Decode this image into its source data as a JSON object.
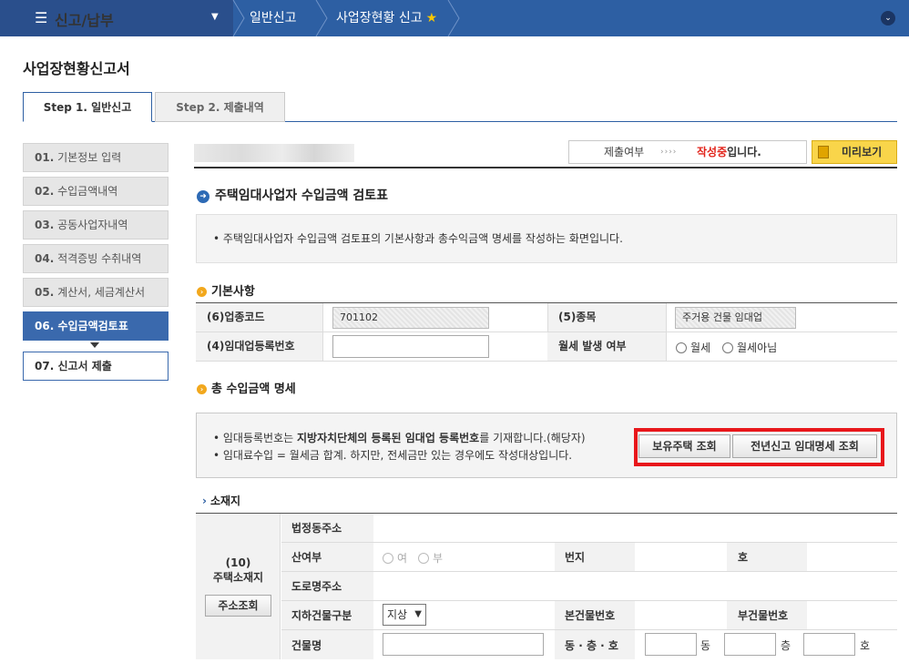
{
  "nav": {
    "menu_label": "신고/납부",
    "crumb1": "일반신고",
    "crumb2": "사업장현황 신고",
    "star": "★"
  },
  "page": {
    "title": "사업장현황신고서"
  },
  "tabs": {
    "step1": "Step 1. 일반신고",
    "step2": "Step 2. 제출내역"
  },
  "sidebar": {
    "items": [
      {
        "num": "01.",
        "label": "기본정보 입력"
      },
      {
        "num": "02.",
        "label": "수입금액내역"
      },
      {
        "num": "03.",
        "label": "공동사업자내역"
      },
      {
        "num": "04.",
        "label": "적격증빙 수취내역"
      },
      {
        "num": "05.",
        "label": "계산서, 세금계산서"
      },
      {
        "num": "06.",
        "label": "수입금액검토표"
      },
      {
        "num": "07.",
        "label": "신고서 제출"
      }
    ]
  },
  "status": {
    "label": "제출여부",
    "arrows": "››››",
    "value": "작성중",
    "suffix": "입니다."
  },
  "preview_button": "미리보기",
  "section": {
    "title": "주택임대사업자 수입금액 검토표",
    "info": "• 주택임대사업자 수입금액 검토표의 기본사항과 총수익금액 명세를 작성하는 화면입니다."
  },
  "basic": {
    "title": "기본사항",
    "industry_code_label": "(6)업종코드",
    "industry_code_value": "701102",
    "type_label": "(5)종목",
    "type_value": "주거용 건물 임대업",
    "reg_no_label": "(4)임대업등록번호",
    "reg_no_value": "",
    "monthly_label": "월세 발생 여부",
    "monthly_yes": "월세",
    "monthly_no": "월세아님"
  },
  "income": {
    "title": "총 수입금액 명세",
    "notice1_a": "• 임대등록번호는 ",
    "notice1_b": "지방자치단체의 등록된 임대업 등록번호",
    "notice1_c": "를 기재합니다.(해당자)",
    "notice2": "• 임대료수입 = 월세금 합계. 하지만, 전세금만 있는 경우에도 작성대상입니다.",
    "btn_owned": "보유주택 조회",
    "btn_prev": "전년신고 임대명세 조회"
  },
  "location": {
    "title": "소재지",
    "left_title_1": "(10)",
    "left_title_2": "주택소재지",
    "addr_btn": "주소조회",
    "legal_addr": "법정동주소",
    "mountain": "산여부",
    "mountain_yes": "여",
    "mountain_no": "부",
    "lot": "번지",
    "ho": "호",
    "road_addr": "도로명주소",
    "underground": "지하건물구분",
    "underground_value": "지상",
    "main_bldg": "본건물번호",
    "sub_bldg": "부건물번호",
    "bldg_name": "건물명",
    "dong_floor_ho": "동 · 층 · 호",
    "unit_dong": "동",
    "unit_floor": "층",
    "unit_ho": "호"
  }
}
